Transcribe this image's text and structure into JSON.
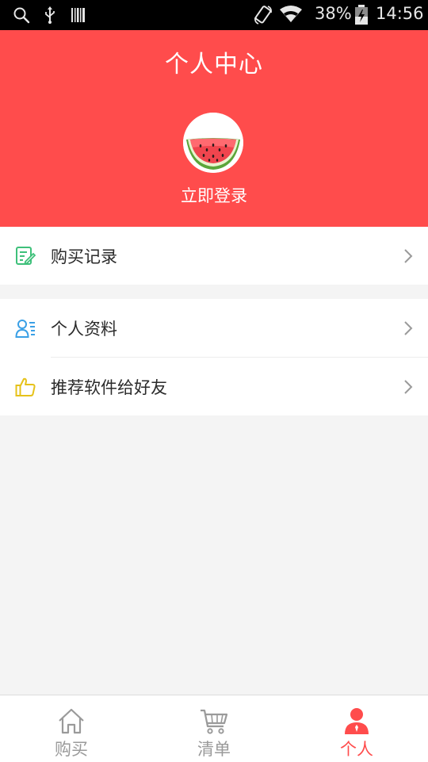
{
  "status_bar": {
    "battery": "38%",
    "time": "14:56",
    "icons": [
      "search-icon",
      "usb-icon",
      "barcode-icon",
      "rotate-icon",
      "wifi-icon",
      "battery-icon"
    ]
  },
  "header": {
    "title": "个人中心",
    "login_label": "立即登录",
    "background_color": "#ff4c4c"
  },
  "menu": {
    "group1": [
      {
        "label": "购买记录",
        "icon": "purchase-record-icon",
        "icon_color": "#3ec07a"
      }
    ],
    "group2": [
      {
        "label": "个人资料",
        "icon": "profile-icon",
        "icon_color": "#3aa0e6"
      },
      {
        "label": "推荐软件给好友",
        "icon": "thumbs-up-icon",
        "icon_color": "#e6c21a"
      }
    ]
  },
  "bottom_nav": {
    "tabs": [
      {
        "label": "购买",
        "icon": "home-icon",
        "active": false
      },
      {
        "label": "清单",
        "icon": "cart-icon",
        "active": false
      },
      {
        "label": "个人",
        "icon": "person-icon",
        "active": true
      }
    ],
    "active_color": "#ff4c4c",
    "inactive_color": "#9a9a9a"
  }
}
